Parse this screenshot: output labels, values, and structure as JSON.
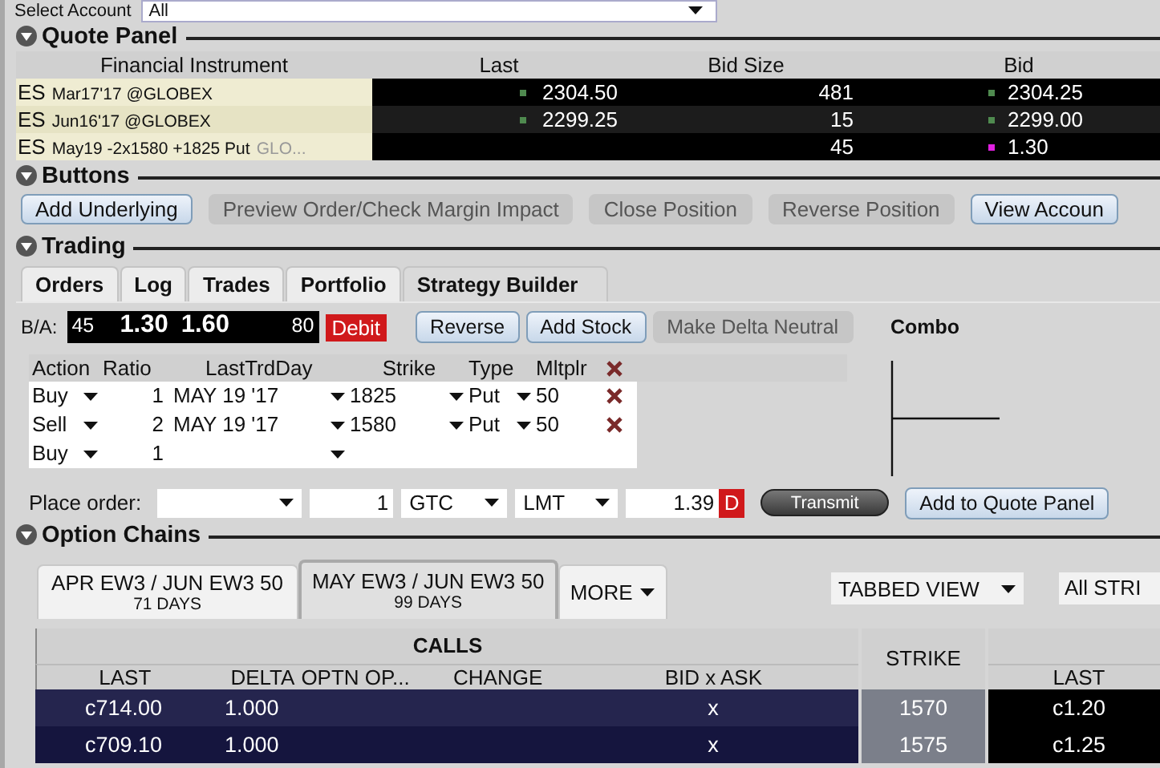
{
  "account": {
    "label": "Select Account",
    "value": "All"
  },
  "quote_panel": {
    "title": "Quote Panel",
    "expanded": true,
    "columns": [
      "Financial Instrument",
      "Last",
      "Bid Size",
      "Bid"
    ],
    "rows": [
      {
        "symbol": "ES",
        "contract": "Mar17'17 @GLOBEX",
        "last": {
          "value": "2304.50",
          "color": "#4f8a4f"
        },
        "bid_size": "481",
        "bid": {
          "value": "2304.25",
          "color": "#4f8a4f"
        }
      },
      {
        "symbol": "ES",
        "contract": "Jun16'17 @GLOBEX",
        "last": {
          "value": "2299.25",
          "color": "#4f8a4f"
        },
        "bid_size": "15",
        "bid": {
          "value": "2299.00",
          "color": "#4f8a4f"
        }
      },
      {
        "symbol": "ES",
        "contract": "May19 -2x1580 +1825 Put",
        "exchange": "GLO...",
        "bid_size": "45",
        "bid": {
          "value": "1.30",
          "color": "#e020e0"
        }
      }
    ]
  },
  "buttons": {
    "title": "Buttons",
    "expanded": true,
    "items": [
      {
        "label": "Add Underlying",
        "disabled": false
      },
      {
        "label": "Preview Order/Check Margin Impact",
        "disabled": true
      },
      {
        "label": "Close Position",
        "disabled": true
      },
      {
        "label": "Reverse Position",
        "disabled": true
      },
      {
        "label": "View Accoun",
        "disabled": false
      }
    ]
  },
  "trading": {
    "title": "Trading",
    "expanded": true,
    "tabs": [
      {
        "label": "Orders",
        "selected": false
      },
      {
        "label": "Log",
        "selected": false
      },
      {
        "label": "Trades",
        "selected": false
      },
      {
        "label": "Portfolio",
        "selected": false
      },
      {
        "label": "Strategy Builder",
        "selected": true
      }
    ],
    "bid_ask": {
      "label": "B/A:",
      "bid_size": "45",
      "bid": "1.30",
      "ask": "1.60",
      "ask_size": "80",
      "side": "Debit"
    },
    "actions": [
      {
        "label": "Reverse",
        "disabled": false
      },
      {
        "label": "Add Stock",
        "disabled": false
      },
      {
        "label": "Make Delta Neutral",
        "disabled": true
      }
    ],
    "combo": {
      "label": "Combo"
    },
    "legs": {
      "columns": [
        "Action",
        "Ratio",
        "LastTrdDay",
        "Strike",
        "Type",
        "Mltplr"
      ],
      "rows": [
        {
          "action": "Buy",
          "ratio": "1",
          "last_trd_day": "MAY 19 '17",
          "strike": "1825",
          "type": "Put",
          "multiplier": "50",
          "removable": true
        },
        {
          "action": "Sell",
          "ratio": "2",
          "last_trd_day": "MAY 19 '17",
          "strike": "1580",
          "type": "Put",
          "multiplier": "50",
          "removable": true
        },
        {
          "action": "Buy",
          "ratio": "1",
          "removable": false
        }
      ]
    },
    "place_order": {
      "label": "Place order:",
      "quantity": "1",
      "tif": "GTC",
      "order_type": "LMT",
      "price": "1.39",
      "side_flag": "D",
      "transmit": "Transmit",
      "add_button": "Add to Quote Panel"
    }
  },
  "option_chains": {
    "title": "Option Chains",
    "expanded": true,
    "tabs": [
      {
        "label": "APR EW3 / JUN EW3 50",
        "days": "71 DAYS",
        "selected": false
      },
      {
        "label": "MAY EW3 / JUN EW3 50",
        "days": "99 DAYS",
        "selected": true
      }
    ],
    "more": "MORE",
    "view": "TABBED VIEW",
    "filter": "All STRI",
    "table": {
      "group": "CALLS",
      "columns": [
        "LAST",
        "DELTA",
        "OPTN OP...",
        "CHANGE",
        "BID x  ASK"
      ],
      "strike_header": "STRIKE",
      "put_columns": [
        "LAST"
      ],
      "rows": [
        {
          "last": "c714.00",
          "delta": "1.000",
          "bid_ask": "x",
          "strike": "1570",
          "put_last": "c1.20"
        },
        {
          "last": "c709.10",
          "delta": "1.000",
          "bid_ask": "x",
          "strike": "1575",
          "put_last": "c1.25"
        }
      ]
    }
  }
}
